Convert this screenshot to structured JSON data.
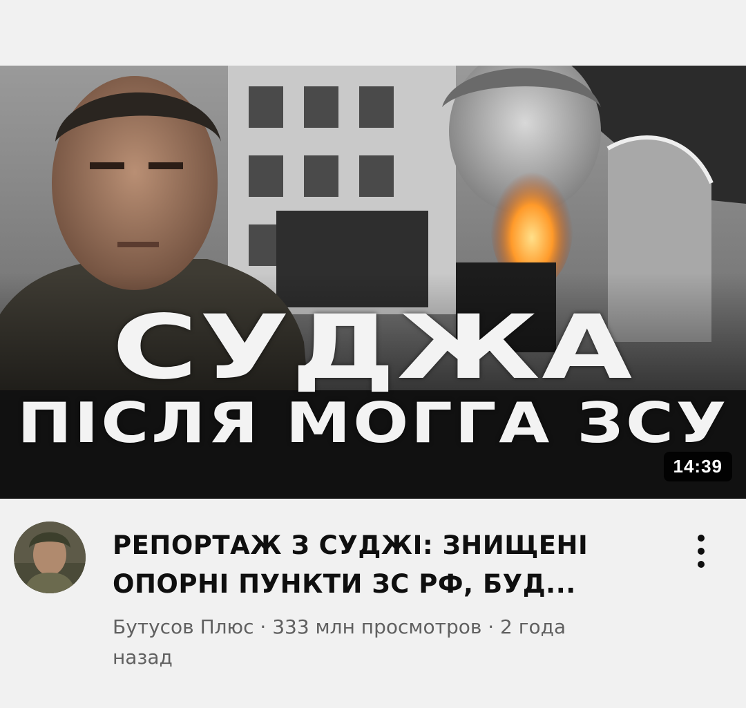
{
  "video": {
    "thumbnail": {
      "headline_main": "СУДЖА",
      "headline_sub": "ПІСЛЯ МОГГА ЗСУ",
      "duration": "14:39"
    },
    "title_line1": "РЕПОРТАЖ З СУДЖІ: ЗНИЩЕНІ",
    "title_line2": "ОПОРНІ ПУНКТИ ЗС РФ, БУД...",
    "meta_line1": "Бутусов Плюс · 333 млн просмотров · 2 года",
    "meta_line2": "назад",
    "channel_avatar": "avatar-image",
    "more_icon": "more-vert-icon"
  }
}
